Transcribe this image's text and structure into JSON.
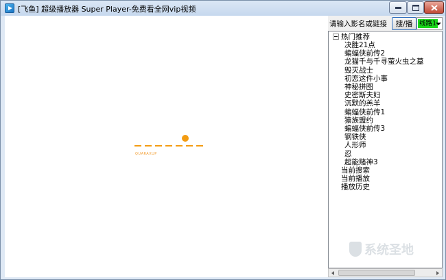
{
  "window": {
    "title": "[飞鱼] 超级播放器 Super Player-免费看全网vip视频"
  },
  "player": {
    "loader_label": "QUARAXUP"
  },
  "controls": {
    "search_label": "请输入影名或链接",
    "play_button": "搜/播",
    "line_value": "线路1"
  },
  "tree": {
    "group_label": "热门推荐",
    "hot_items": [
      "决胜21点",
      "蝙蝠侠前传2",
      "龙猫千与千寻萤火虫之墓",
      "毁灭战士",
      "初恋这件小事",
      "神秘拼图",
      "史密斯夫妇",
      "沉默的羔羊",
      "蝙蝠侠前传1",
      "猿族盟约",
      "蝙蝠侠前传3",
      "钢铁侠",
      "人形师",
      "忍",
      "超能赌神3"
    ],
    "top_items": [
      "当前搜索",
      "当前播放",
      "播放历史"
    ]
  },
  "watermark": {
    "text": "系统圣地"
  },
  "colors": {
    "loader": "#f39c12",
    "line_highlight": "#1bd71b",
    "titlebar": "#c6d8ee"
  }
}
